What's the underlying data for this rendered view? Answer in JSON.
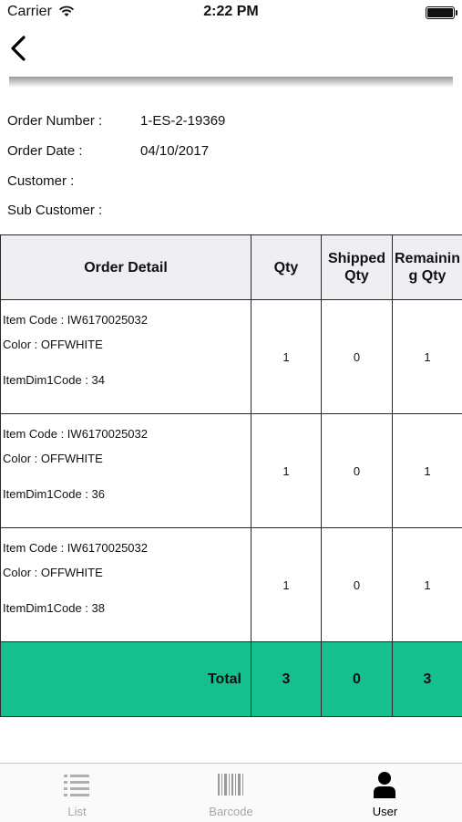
{
  "status_bar": {
    "carrier": "Carrier",
    "time": "2:22 PM"
  },
  "order_info": [
    {
      "label": "Order Number :",
      "value": "1-ES-2-19369"
    },
    {
      "label": "Order Date :",
      "value": "04/10/2017"
    },
    {
      "label": "Customer :",
      "value": ""
    },
    {
      "label": "Sub Customer :",
      "value": ""
    }
  ],
  "table": {
    "headers": {
      "detail": "Order Detail",
      "qty": "Qty",
      "shipped": "Shipped Qty",
      "remaining": "Remaining Qty"
    },
    "rows": [
      {
        "item_code": "Item Code :  IW6170025032",
        "color": "Color :  OFFWHITE",
        "dim": "ItemDim1Code :  34",
        "qty": "1",
        "shipped": "0",
        "remaining": "1"
      },
      {
        "item_code": "Item Code :  IW6170025032",
        "color": "Color :  OFFWHITE",
        "dim": "ItemDim1Code :  36",
        "qty": "1",
        "shipped": "0",
        "remaining": "1"
      },
      {
        "item_code": "Item Code :  IW6170025032",
        "color": "Color :  OFFWHITE",
        "dim": "ItemDim1Code :  38",
        "qty": "1",
        "shipped": "0",
        "remaining": "1"
      }
    ],
    "total": {
      "label": "Total",
      "qty": "3",
      "shipped": "0",
      "remaining": "3"
    }
  },
  "tab_bar": {
    "tabs": [
      {
        "label": "List",
        "icon": "list-icon"
      },
      {
        "label": "Barcode",
        "icon": "barcode-icon"
      },
      {
        "label": "User",
        "icon": "user-icon"
      }
    ],
    "active": "User"
  },
  "colors": {
    "total_row": "#16c08e",
    "header_bg": "#eeeef3",
    "inactive_tab": "#a8a8a8"
  }
}
